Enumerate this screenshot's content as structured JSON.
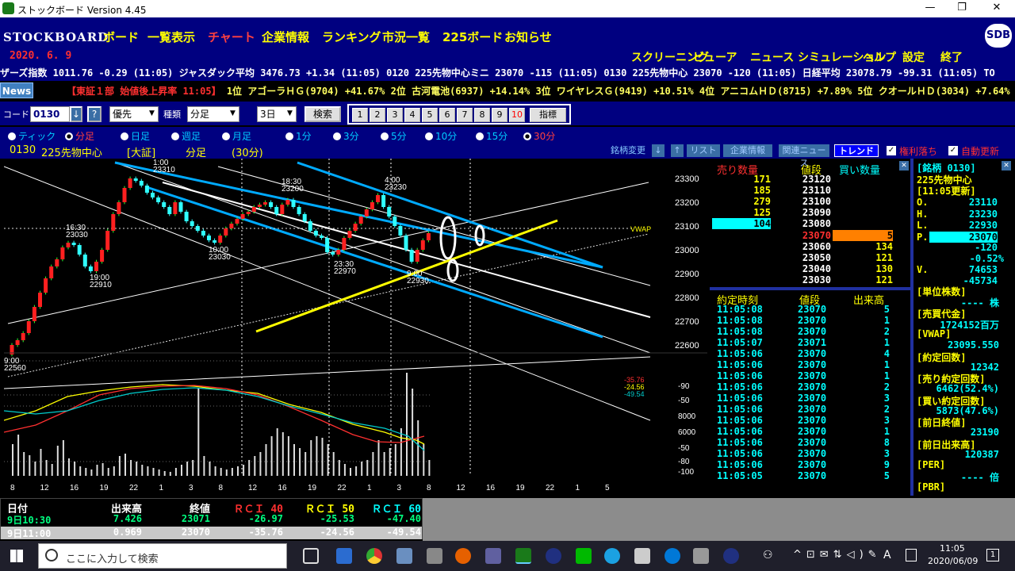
{
  "window": {
    "title": "ストックボード Version 4.45",
    "min": "—",
    "max": "❐",
    "close": "✕"
  },
  "app": {
    "logo": "STOCKBOARD",
    "menu": [
      "ボード",
      "一覧表示",
      "チャート",
      "企業情報",
      "ランキング",
      "市況一覧",
      "225ボード",
      "お知らせ"
    ],
    "active_menu": "チャート",
    "sdb": "SDB",
    "date": "2020. 6. 9",
    "submenu": [
      "スクリーニング",
      "ビューア",
      "ニュース",
      "シミュレーション",
      "ヘルプ",
      "設定",
      "終了"
    ]
  },
  "ticker": "ザーズ指数 1011.76 -0.29 (11:05)  ジャスダック平均 3476.73 +1.34 (11:05)  0120 225先物中心ミニ 23070 -115 (11:05)  0130 225先物中心 23070 -120 (11:05)  日経平均 23078.79 -99.31 (11:05)  TO",
  "news": {
    "button": "News",
    "text_red": "【東証１部 始値後上昇率 11:05】",
    "text_yellow": "1位 アゴーラＨＧ(9704) +41.67%  2位 古河電池(6937) +14.14%  3位 ワイヤレスＧ(9419) +10.51%  4位 アニコムＨＤ(8715) +7.89%  5位 クオールＨＤ(3034) +7.64%"
  },
  "controls": {
    "code_label": "コード",
    "code": "0130",
    "code_down": "↓",
    "code_help": "?",
    "priority": "優先",
    "kind_label": "種類",
    "kind": "分足",
    "period": "3日",
    "search": "検索",
    "numbers": [
      "1",
      "2",
      "3",
      "4",
      "5",
      "6",
      "7",
      "8",
      "9",
      "10"
    ],
    "indicator": "指標"
  },
  "radios": [
    "ティック",
    "分足",
    "日足",
    "週足",
    "月足",
    "1分",
    "3分",
    "5分",
    "10分",
    "15分",
    "30分"
  ],
  "radio_on": [
    "分足",
    "30分"
  ],
  "info": {
    "code": "0130",
    "name": "225先物中心",
    "market": "[大証]",
    "kind": "分足",
    "interval": "(30分)",
    "tools": [
      "銘柄変更",
      "↓",
      "↑",
      "リスト",
      "企業情報",
      "関連ニュース",
      "トレンド"
    ],
    "check1": "権利落ち",
    "check2": "自動更新"
  },
  "chart_data": {
    "type": "candlestick",
    "title": "0130 225先物中心 [大証] 分足 (30分)",
    "y_ticks": [
      23300,
      23200,
      23100,
      23000,
      22900,
      22800,
      22700,
      22600
    ],
    "vwap_label": "VWAP",
    "vwap": 23095.55,
    "annotations": [
      {
        "t": "9:00",
        "v": "22560"
      },
      {
        "t": "16:30",
        "v": "23030"
      },
      {
        "t": "19:00",
        "v": "22910"
      },
      {
        "t": "1:00",
        "v": "23310"
      },
      {
        "t": "10:00",
        "v": "23030"
      },
      {
        "t": "18:30",
        "v": "23200"
      },
      {
        "t": "23:30",
        "v": "22970"
      },
      {
        "t": "4:00",
        "v": "23230"
      },
      {
        "t": "9:00",
        "v": "22930"
      }
    ],
    "x_ticks": [
      "8",
      "12",
      "16",
      "19",
      "22",
      "1",
      "3",
      "8",
      "12",
      "16",
      "19",
      "22",
      "1",
      "3",
      "8",
      "12",
      "16",
      "19",
      "22",
      "1",
      "5"
    ],
    "indicator_ticks": [
      "-90",
      "-50",
      "8000",
      "6000",
      "-50",
      "-80",
      "-100"
    ],
    "rci_values": [
      "-35.76",
      "-24.56",
      "-49.54"
    ]
  },
  "order_book": {
    "headers": [
      "売り数量",
      "値段",
      "買い数量"
    ],
    "rows": [
      [
        "171",
        "23120",
        ""
      ],
      [
        "185",
        "23110",
        ""
      ],
      [
        "279",
        "23100",
        ""
      ],
      [
        "125",
        "23090",
        ""
      ],
      [
        "104",
        "23080",
        ""
      ],
      [
        "",
        "23070",
        "5"
      ],
      [
        "",
        "23060",
        "134"
      ],
      [
        "",
        "23050",
        "121"
      ],
      [
        "",
        "23040",
        "130"
      ],
      [
        "",
        "23030",
        "121"
      ]
    ]
  },
  "trades": {
    "headers": [
      "約定時刻",
      "値段",
      "出来高"
    ],
    "rows": [
      [
        "11:05:08",
        "23070",
        "5"
      ],
      [
        "11:05:08",
        "23070",
        "1"
      ],
      [
        "11:05:08",
        "23070",
        "2"
      ],
      [
        "11:05:07",
        "23071",
        "1"
      ],
      [
        "11:05:06",
        "23070",
        "4"
      ],
      [
        "11:05:06",
        "23070",
        "1"
      ],
      [
        "11:05:06",
        "23070",
        "1"
      ],
      [
        "11:05:06",
        "23070",
        "2"
      ],
      [
        "11:05:06",
        "23070",
        "3"
      ],
      [
        "11:05:06",
        "23070",
        "2"
      ],
      [
        "11:05:06",
        "23070",
        "3"
      ],
      [
        "11:05:06",
        "23070",
        "1"
      ],
      [
        "11:05:06",
        "23070",
        "8"
      ],
      [
        "11:05:06",
        "23070",
        "3"
      ],
      [
        "11:05:06",
        "23070",
        "9"
      ],
      [
        "11:05:05",
        "23070",
        "5"
      ]
    ]
  },
  "detail": {
    "title": "[銘柄 0130]",
    "name": "225先物中心",
    "updated": "[11:05更新]",
    "ohlc": [
      [
        "O.",
        "23110"
      ],
      [
        "H.",
        "23230"
      ],
      [
        "L.",
        "22930"
      ],
      [
        "P.",
        "23070"
      ]
    ],
    "change": "-120",
    "change_pct": "-0.52%",
    "vol_label": "V.",
    "volume": "74653",
    "vol_change": "-45734",
    "items": [
      [
        "[単位株数]",
        "---- 株"
      ],
      [
        "[売買代金]",
        "1724152百万"
      ],
      [
        "[VWAP]",
        "23095.550"
      ],
      [
        "[約定回数]",
        "12342"
      ],
      [
        "[売り約定回数]",
        "6462(52.4%)"
      ],
      [
        "[買い約定回数]",
        "5873(47.6%)"
      ],
      [
        "[前日終値]",
        "23190"
      ],
      [
        "[前日出来高]",
        "120387"
      ],
      [
        "[PER]",
        "---- 倍"
      ],
      [
        "[PBR]",
        ""
      ]
    ]
  },
  "footer": {
    "headers": [
      "日付",
      "出来高",
      "終値",
      "ＲＣＩ 40",
      "ＲＣＩ 50",
      "ＲＣＩ 60"
    ],
    "rows": [
      [
        "9日10:30",
        "7.426",
        "23071",
        "-26.97",
        "-25.53",
        "-47.40"
      ],
      [
        "9日11:00",
        "0.969",
        "23070",
        "-35.76",
        "-24.56",
        "-49.54"
      ]
    ]
  },
  "taskbar": {
    "search": "ここに入力して検索",
    "time": "11:05",
    "date": "2020/06/09",
    "ime": "A"
  }
}
